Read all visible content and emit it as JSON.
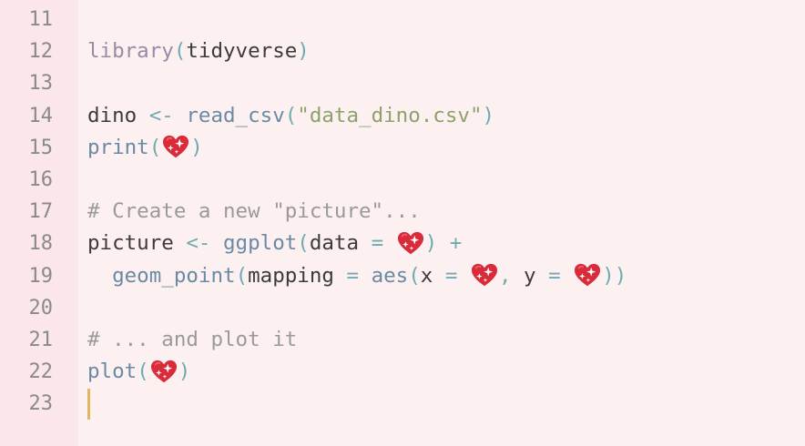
{
  "gutter": {
    "line_numbers": [
      "11",
      "12",
      "13",
      "14",
      "15",
      "16",
      "17",
      "18",
      "19",
      "20",
      "21",
      "22",
      "23"
    ]
  },
  "code": {
    "l12": {
      "fn": "library",
      "open": "(",
      "arg": "tidyverse",
      "close": ")"
    },
    "l14": {
      "var": "dino ",
      "assign": "<- ",
      "fn": "read_csv",
      "open": "(",
      "str": "\"data_dino.csv\"",
      "close": ")"
    },
    "l15": {
      "fn": "print",
      "open": "(",
      "close": ")"
    },
    "l17": {
      "comment": "# Create a new \"picture\"..."
    },
    "l18": {
      "var": "picture ",
      "assign": "<- ",
      "fn": "ggplot",
      "open": "(",
      "arg": "data ",
      "eq": "= ",
      "close": ")",
      "plus": " +"
    },
    "l19": {
      "indent": "  ",
      "fn": "geom_point",
      "open": "(",
      "arg": "mapping ",
      "eq": "= ",
      "fn2": "aes",
      "open2": "(",
      "x": "x ",
      "eq2": "= ",
      "comma": ", ",
      "y": "y ",
      "eq3": "= ",
      "close": "))"
    },
    "l21": {
      "comment": "# ... and plot it"
    },
    "l22": {
      "fn": "plot",
      "open": "(",
      "close": ")"
    }
  },
  "icons": {
    "heart": "sparkling-heart-emoji"
  },
  "colors": {
    "background": "#fdf0f1",
    "gutter": "#fbe7e9",
    "cursor": "#e2b65c",
    "function": "#6a8aa4",
    "string": "#8da16b",
    "operator": "#6eabb0",
    "comment": "#9a9a9a"
  }
}
